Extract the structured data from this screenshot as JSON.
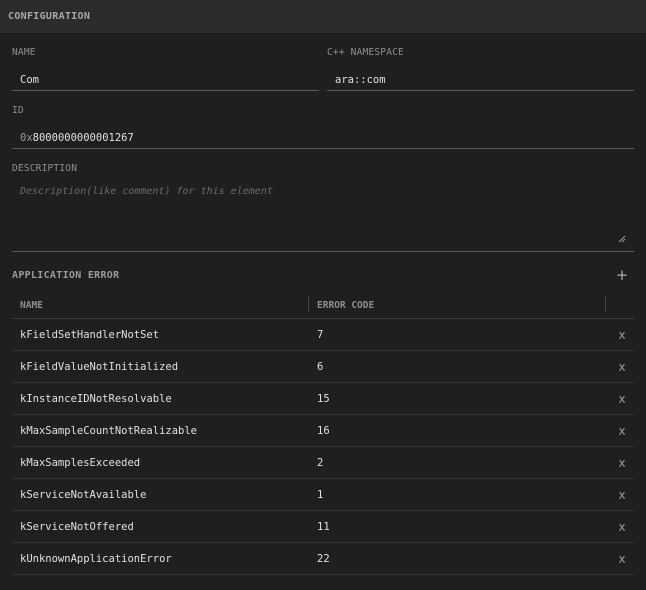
{
  "header": {
    "title": "CONFIGURATION"
  },
  "form": {
    "name_label": "NAME",
    "name_value": "Com",
    "namespace_label": "C++ NAMESPACE",
    "namespace_value": "ara::com",
    "id_label": "ID",
    "id_prefix": "0x",
    "id_value": "8000000000001267",
    "description_label": "DESCRIPTION",
    "description_placeholder": "Description(like comment) for this element"
  },
  "errors": {
    "section_title": "APPLICATION ERROR",
    "add_icon": "+",
    "columns": [
      "NAME",
      "ERROR CODE"
    ],
    "delete_icon": "x",
    "rows": [
      {
        "name": "kFieldSetHandlerNotSet",
        "code": "7"
      },
      {
        "name": "kFieldValueNotInitialized",
        "code": "6"
      },
      {
        "name": "kInstanceIDNotResolvable",
        "code": "15"
      },
      {
        "name": "kMaxSampleCountNotRealizable",
        "code": "16"
      },
      {
        "name": "kMaxSamplesExceeded",
        "code": "2"
      },
      {
        "name": "kServiceNotAvailable",
        "code": "1"
      },
      {
        "name": "kServiceNotOffered",
        "code": "11"
      },
      {
        "name": "kUnknownApplicationError",
        "code": "22"
      }
    ]
  }
}
